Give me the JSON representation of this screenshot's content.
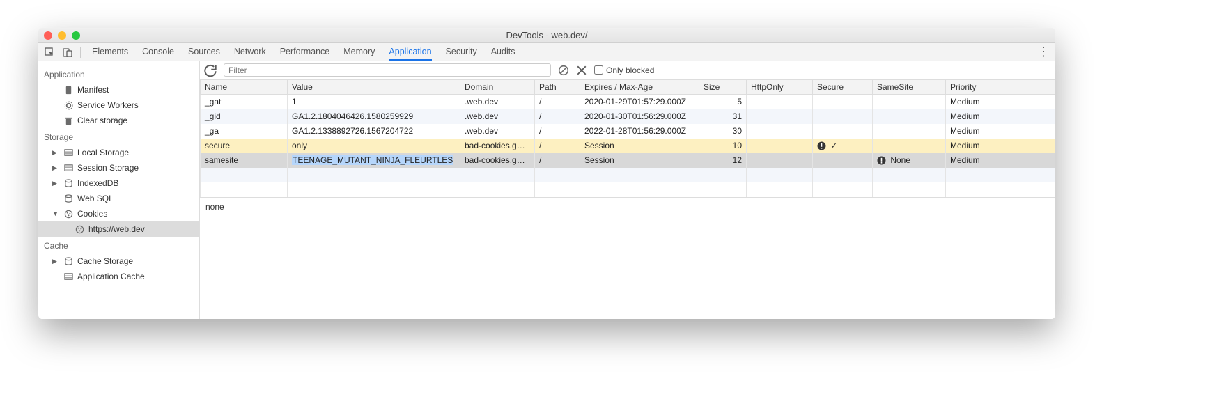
{
  "window": {
    "title": "DevTools - web.dev/"
  },
  "tabs": [
    "Elements",
    "Console",
    "Sources",
    "Network",
    "Performance",
    "Memory",
    "Application",
    "Security",
    "Audits"
  ],
  "active_tab": "Application",
  "sidebar": {
    "groups": [
      {
        "title": "Application",
        "items": [
          {
            "label": "Manifest",
            "icon": "doc"
          },
          {
            "label": "Service Workers",
            "icon": "gear"
          },
          {
            "label": "Clear storage",
            "icon": "trash"
          }
        ]
      },
      {
        "title": "Storage",
        "items": [
          {
            "label": "Local Storage",
            "icon": "table",
            "expandable": true
          },
          {
            "label": "Session Storage",
            "icon": "table",
            "expandable": true
          },
          {
            "label": "IndexedDB",
            "icon": "db",
            "expandable": true
          },
          {
            "label": "Web SQL",
            "icon": "db"
          },
          {
            "label": "Cookies",
            "icon": "cookie",
            "expandable": true,
            "expanded": true,
            "children": [
              {
                "label": "https://web.dev",
                "icon": "cookie",
                "selected": true
              }
            ]
          }
        ]
      },
      {
        "title": "Cache",
        "items": [
          {
            "label": "Cache Storage",
            "icon": "db",
            "expandable": true
          },
          {
            "label": "Application Cache",
            "icon": "table"
          }
        ]
      }
    ]
  },
  "filter": {
    "placeholder": "Filter",
    "only_blocked_label": "Only blocked"
  },
  "columns": [
    "Name",
    "Value",
    "Domain",
    "Path",
    "Expires / Max-Age",
    "Size",
    "HttpOnly",
    "Secure",
    "SameSite",
    "Priority"
  ],
  "cookies": [
    {
      "name": "_gat",
      "value": "1",
      "domain": ".web.dev",
      "path": "/",
      "expires": "2020-01-29T01:57:29.000Z",
      "size": "5",
      "httpOnly": "",
      "secure": "",
      "sameSite": "",
      "priority": "Medium"
    },
    {
      "name": "_gid",
      "value": "GA1.2.1804046426.1580259929",
      "domain": ".web.dev",
      "path": "/",
      "expires": "2020-01-30T01:56:29.000Z",
      "size": "31",
      "httpOnly": "",
      "secure": "",
      "sameSite": "",
      "priority": "Medium"
    },
    {
      "name": "_ga",
      "value": "GA1.2.1338892726.1567204722",
      "domain": ".web.dev",
      "path": "/",
      "expires": "2022-01-28T01:56:29.000Z",
      "size": "30",
      "httpOnly": "",
      "secure": "",
      "sameSite": "",
      "priority": "Medium"
    },
    {
      "name": "secure",
      "value": "only",
      "domain": "bad-cookies.g…",
      "path": "/",
      "expires": "Session",
      "size": "10",
      "httpOnly": "",
      "secure": "warn-check",
      "sameSite": "",
      "priority": "Medium",
      "row": "hl"
    },
    {
      "name": "samesite",
      "value": "TEENAGE_MUTANT_NINJA_FLEURTLES",
      "domain": "bad-cookies.g…",
      "path": "/",
      "expires": "Session",
      "size": "12",
      "httpOnly": "",
      "secure": "",
      "sameSite": "warn-none",
      "sameSiteText": "None",
      "priority": "Medium",
      "row": "sel",
      "value_selected": true
    }
  ],
  "detail_value": "none"
}
